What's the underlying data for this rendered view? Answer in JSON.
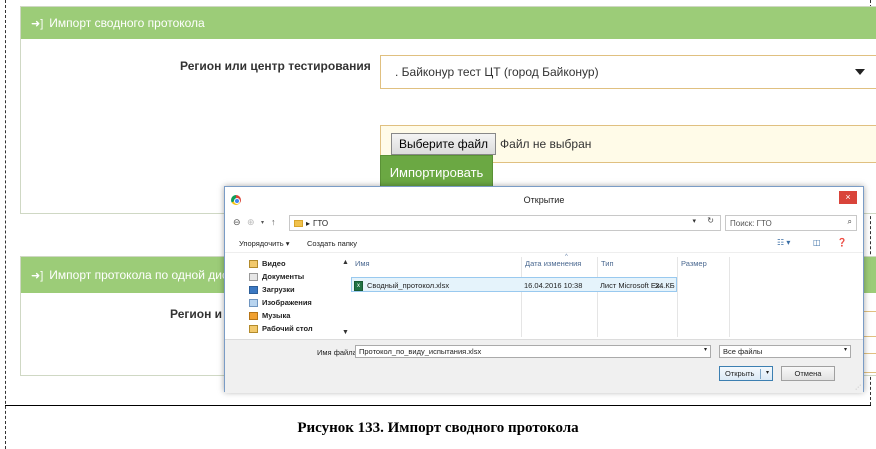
{
  "panel1": {
    "title": "Импорт сводного протокола",
    "region_label": "Регион или центр тестирования",
    "region_value": ". Байконур тест ЦТ (город Байконур)",
    "file_button": "Выберите файл",
    "file_status": "Файл не выбран",
    "import_button": "Импортировать"
  },
  "panel2": {
    "title": "Импорт протокола по одной дисц",
    "region_label": "Регион и"
  },
  "dialog": {
    "title": "Открытие",
    "close": "×",
    "address": "ГТО",
    "search_placeholder": "Поиск: ГТО",
    "toolbar": {
      "organize": "Упорядочить ▾",
      "new_folder": "Создать папку"
    },
    "nav_items": [
      {
        "label": "Видео",
        "icon": "video-folder-icon"
      },
      {
        "label": "Документы",
        "icon": "documents-folder-icon"
      },
      {
        "label": "Загрузки",
        "icon": "downloads-folder-icon"
      },
      {
        "label": "Изображения",
        "icon": "images-folder-icon"
      },
      {
        "label": "Музыка",
        "icon": "music-folder-icon"
      },
      {
        "label": "Рабочий стол",
        "icon": "desktop-folder-icon"
      }
    ],
    "columns": {
      "name": "Имя",
      "modified": "Дата изменения",
      "type": "Тип",
      "size": "Размер"
    },
    "files": [
      {
        "name": "Сводный_протокол.xlsx",
        "modified": "16.04.2016 10:38",
        "type": "Лист Microsoft Ex...",
        "size": "24 КБ"
      }
    ],
    "filename_label": "Имя файла:",
    "filename_value": "Протокол_по_виду_испытания.xlsx",
    "filter_value": "Все файлы",
    "open_button": "Открыть",
    "cancel_button": "Отмена"
  },
  "caption": "Рисунок 133. Импорт сводного протокола",
  "colors": {
    "header_green": "#9ccc78",
    "button_green": "#6ba843",
    "field_border": "#e0c080",
    "close_red": "#d9443a"
  }
}
